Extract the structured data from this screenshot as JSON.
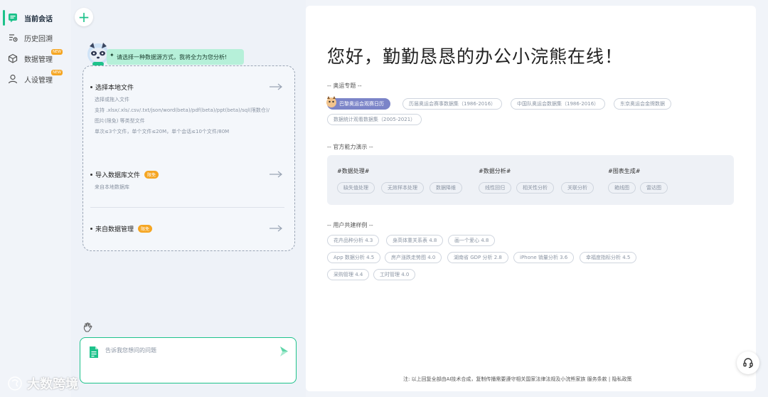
{
  "nav": {
    "items": [
      {
        "label": "当前会话",
        "icon": "chat-icon",
        "active": true
      },
      {
        "label": "历史回溯",
        "icon": "history-list-icon"
      },
      {
        "label": "数据管理",
        "icon": "cube-icon",
        "badge": "NEW"
      },
      {
        "label": "人设管理",
        "icon": "person-icon",
        "badge": "NEW"
      }
    ]
  },
  "mid": {
    "prompt": "请选择一种数据源方式，我将全力为您分析!",
    "options": [
      {
        "title": "选择本地文件",
        "lines": [
          "选择或拖入文件",
          "支持 .xlsx/.xls/.csv/.txt/json/word(beta)/pdf(beta)/ppt(beta)/sql(限数仓)/图片(限免) 等类型文件",
          "单次≤3个文件，单个文件≤20M，单个会话≤10个文件/80M"
        ]
      },
      {
        "title": "导入数据库文件",
        "badge": "限免",
        "lines": [
          "来自本地数据库"
        ]
      },
      {
        "title": "来自数据管理",
        "badge": "限免",
        "lines": []
      }
    ],
    "input_placeholder": "告诉我您想问的问题"
  },
  "watermark": {
    "text": "大数跨境"
  },
  "main": {
    "greeting": "您好，勤勤恳恳的办公小浣熊在线！",
    "sections": {
      "olympic": {
        "title": "-- 奥运专题 --",
        "chips": [
          "巴黎奥运会观赛日历",
          "历届奥运会赛事数据集（1986-2016）",
          "中国队奥运会数据集（1986-2016）",
          "东京奥运会金牌数据",
          "数据统计观看数据集（2005-2021）"
        ]
      },
      "capabilities": {
        "title": "-- 官方能力演示 --",
        "groups": [
          {
            "head": "#数据处理#",
            "chips": [
              "缺失值处理",
              "无效样本处理",
              "数据降维"
            ]
          },
          {
            "head": "#数据分析#",
            "chips": [
              "线性回归",
              "相关性分析",
              "关联分析"
            ]
          },
          {
            "head": "#图表生成#",
            "chips": [
              "箱线图",
              "雷达图"
            ]
          }
        ]
      },
      "user_cases": {
        "title": "-- 用户共建样例 --",
        "rows": [
          [
            "花卉品种分析 4.3",
            "身高体重关系表 4.8",
            "画一个爱心 4.8"
          ],
          [
            "App 数据分析 4.5",
            "房产涨跌走势图 4.0",
            "湖南省 GDP 分析 2.8",
            "iPhone 销量分析 3.6",
            "幸福度指标分析 4.5"
          ],
          [
            "采购管理 4.4",
            "工时管理 4.0"
          ]
        ]
      }
    },
    "footer": "注: 以上回复全部由AI技术合成，复制传播需要遵守相关国家法律法规及小浣熊家族 服务条款 | 隐私政策"
  },
  "colors": {
    "accent": "#1ec28b",
    "badge": "#f5a623",
    "active_chip": "#7b84c8"
  }
}
